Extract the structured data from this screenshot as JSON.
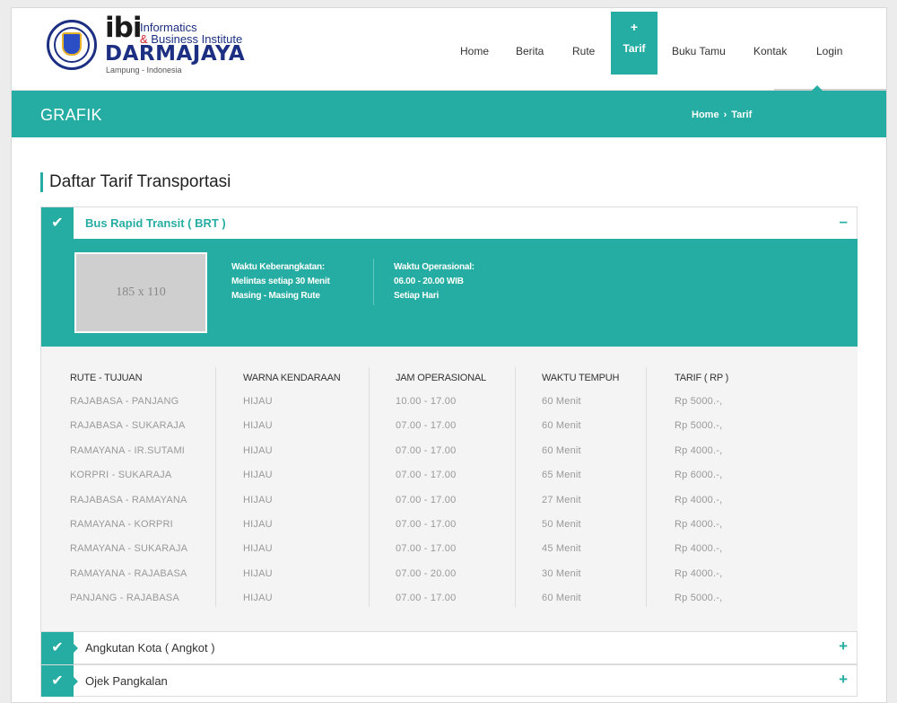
{
  "header": {
    "logo": {
      "ibi": "ibi",
      "tagline_1": "Informatics",
      "tagline_2_amp": "&",
      "tagline_2": "Business Institute",
      "name": "DARMAJAYA",
      "location": "Lampung - Indonesia"
    },
    "nav": [
      {
        "label": "Home"
      },
      {
        "label": "Berita"
      },
      {
        "label": "Rute"
      },
      {
        "label": "Tarif",
        "active": true,
        "icon": "plus-icon"
      },
      {
        "label": "Buku Tamu"
      },
      {
        "label": "Kontak"
      },
      {
        "label": "Login"
      }
    ],
    "nav_active_icon": "+"
  },
  "band": {
    "title": "GRAFIK",
    "breadcrumb": [
      "Home",
      "Tarif"
    ],
    "breadcrumb_sep": "›"
  },
  "section_title": "Daftar Tarif Transportasi",
  "accordion": [
    {
      "title": "Bus Rapid Transit ( BRT )",
      "expanded": true,
      "toggle": "–",
      "check": "✔",
      "image_placeholder": "185 x 110",
      "departure": {
        "label": "Waktu Keberangkatan:",
        "line1": "Melintas setiap 30 Menit",
        "line2": "Masing - Masing Rute"
      },
      "operational": {
        "label": "Waktu Operasional:",
        "line1": "06.00 - 20.00 WIB",
        "line2": "Setiap Hari"
      },
      "columns": [
        "RUTE - TUJUAN",
        "WARNA KENDARAAN",
        "JAM OPERASIONAL",
        "WAKTU TEMPUH",
        "TARIF ( RP )"
      ],
      "rows": [
        [
          "RAJABASA - PANJANG",
          "HIJAU",
          "10.00 - 17.00",
          "60 Menit",
          "Rp 5000.-,"
        ],
        [
          "RAJABASA - SUKARAJA",
          "HIJAU",
          "07.00 - 17.00",
          "60 Menit",
          "Rp 5000.-,"
        ],
        [
          "RAMAYANA - IR.SUTAMI",
          "HIJAU",
          "07.00 - 17.00",
          "60 Menit",
          "Rp 4000.-,"
        ],
        [
          "KORPRI - SUKARAJA",
          "HIJAU",
          "07.00 - 17.00",
          "65 Menit",
          "Rp 6000.-,"
        ],
        [
          "RAJABASA - RAMAYANA",
          "HIJAU",
          "07.00 - 17.00",
          "27 Menit",
          "Rp 4000.-,"
        ],
        [
          "RAMAYANA - KORPRI",
          "HIJAU",
          "07.00 - 17.00",
          "50 Menit",
          "Rp 4000.-,"
        ],
        [
          "RAMAYANA - SUKARAJA",
          "HIJAU",
          "07.00 - 17.00",
          "45 Menit",
          "Rp 4000.-,"
        ],
        [
          "RAMAYANA - RAJABASA",
          "HIJAU",
          "07.00 - 20.00",
          "30 Menit",
          "Rp 4000.-,"
        ],
        [
          "PANJANG - RAJABASA",
          "HIJAU",
          "07.00 - 17.00",
          "60 Menit",
          "Rp 5000.-,"
        ]
      ]
    },
    {
      "title": "Angkutan Kota ( Angkot )",
      "expanded": false,
      "toggle": "+",
      "check": "✔"
    },
    {
      "title": "Ojek Pangkalan",
      "expanded": false,
      "toggle": "+",
      "check": "✔"
    }
  ],
  "colors": {
    "accent": "#26ada3",
    "brand_blue": "#1c2f82",
    "brand_red": "#d21f2c",
    "table_bg": "#f4f4f4"
  }
}
